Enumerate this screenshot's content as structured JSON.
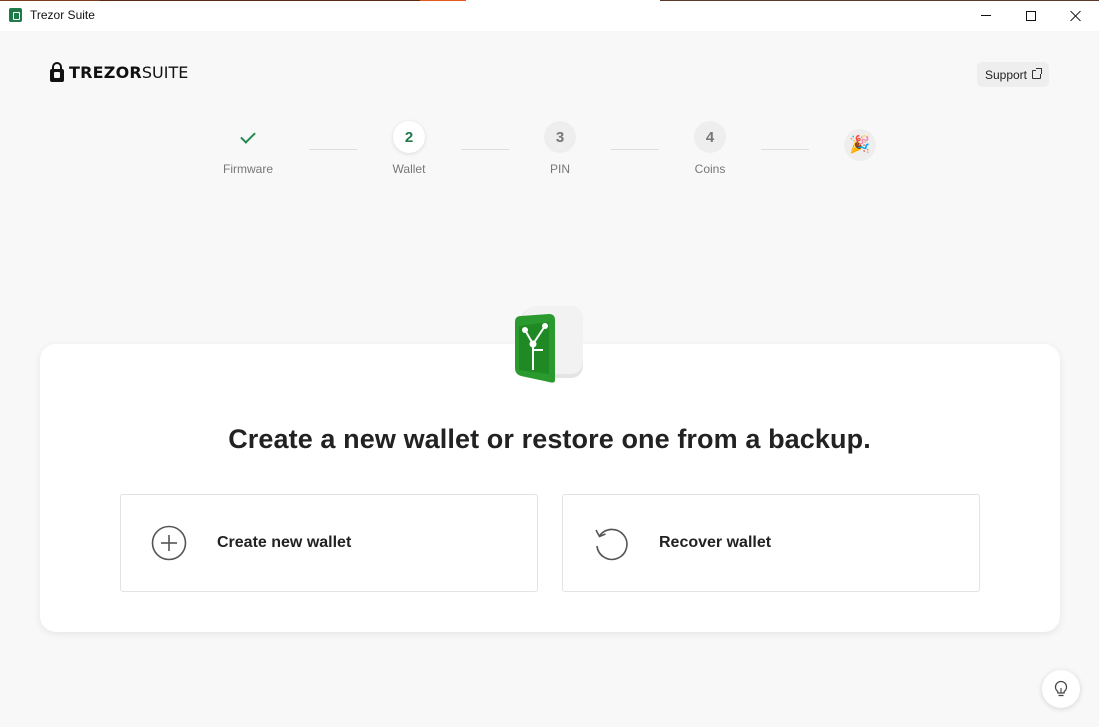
{
  "window": {
    "title": "Trezor Suite"
  },
  "header": {
    "logo_strong": "TREZOR",
    "logo_light": "SUITE",
    "support_label": "Support"
  },
  "steps": [
    {
      "number": "",
      "label": "Firmware",
      "state": "done"
    },
    {
      "number": "2",
      "label": "Wallet",
      "state": "active"
    },
    {
      "number": "3",
      "label": "PIN",
      "state": "pending"
    },
    {
      "number": "4",
      "label": "Coins",
      "state": "pending"
    }
  ],
  "final_step_icon": "party-popper-icon",
  "main": {
    "heading": "Create a new wallet or restore one from a backup.",
    "options": [
      {
        "label": "Create new wallet",
        "icon": "plus-circle-icon"
      },
      {
        "label": "Recover wallet",
        "icon": "recover-arrow-icon"
      }
    ]
  },
  "colors": {
    "brand_green": "#1f7a4a",
    "background": "#f8f8f8"
  }
}
